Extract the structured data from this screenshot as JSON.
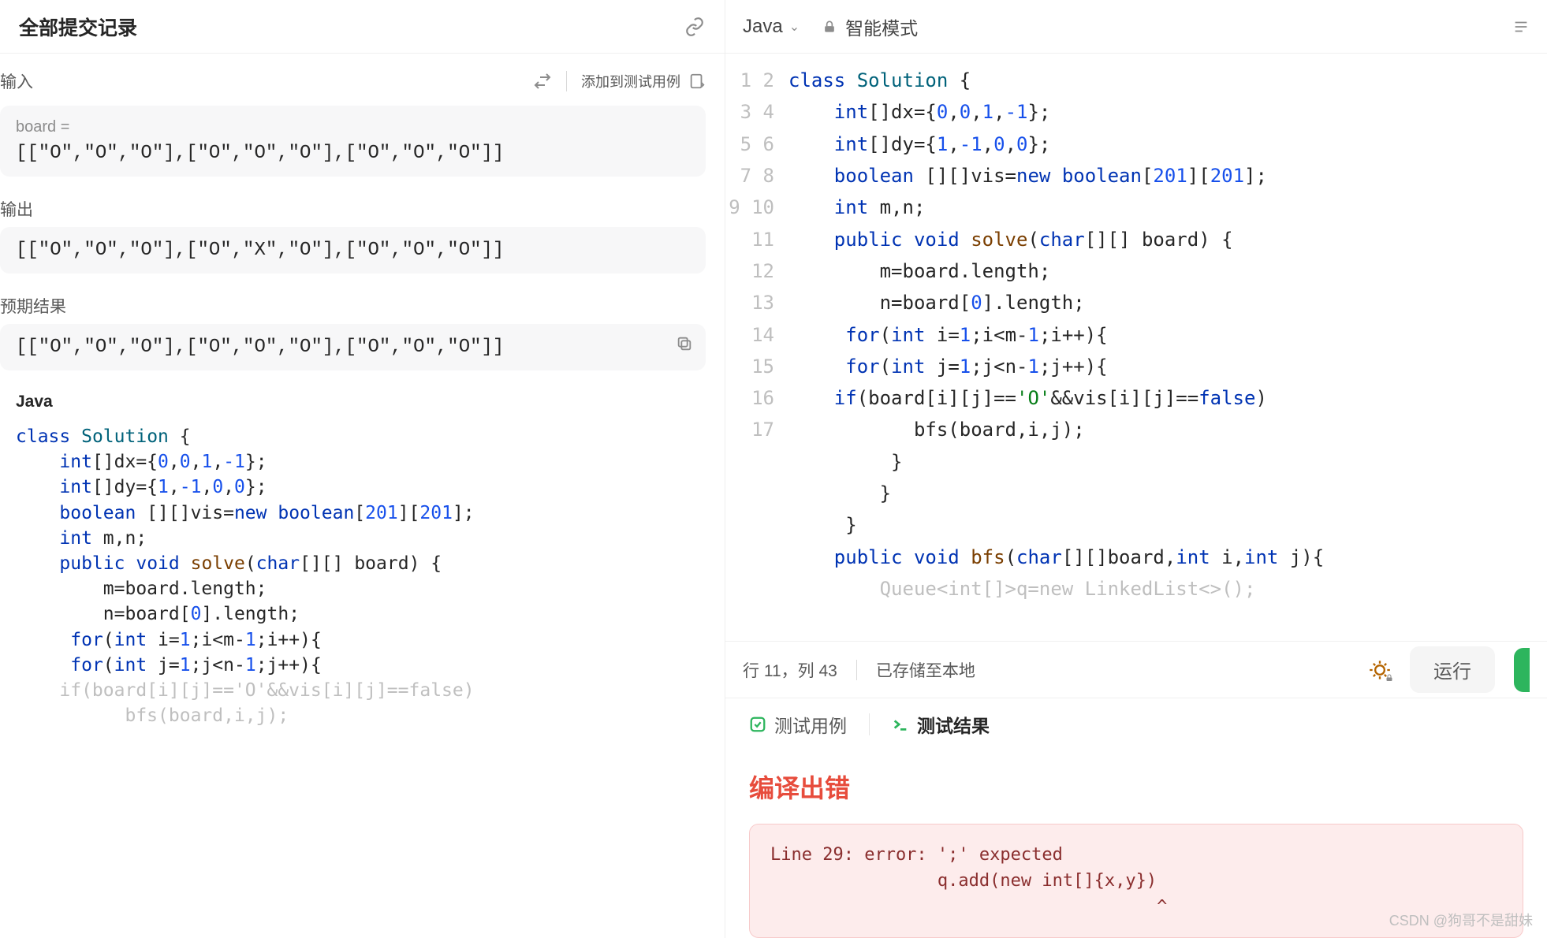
{
  "left": {
    "title": "全部提交记录",
    "input_label": "输入",
    "add_testcase": "添加到测试用例",
    "board_caption": "board =",
    "board_value": "[[\"O\",\"O\",\"O\"],[\"O\",\"O\",\"O\"],[\"O\",\"O\",\"O\"]]",
    "output_label": "输出",
    "output_value": "[[\"O\",\"O\",\"O\"],[\"O\",\"X\",\"O\"],[\"O\",\"O\",\"O\"]]",
    "expected_label": "预期结果",
    "expected_value": "[[\"O\",\"O\",\"O\"],[\"O\",\"O\",\"O\"],[\"O\",\"O\",\"O\"]]",
    "lang_label": "Java"
  },
  "right": {
    "language": "Java",
    "mode": "智能模式",
    "cursor": "行 11，列 43",
    "saved": "已存储至本地",
    "run_button": "运行"
  },
  "tabs": {
    "testcase": "测试用例",
    "result": "测试结果"
  },
  "error": {
    "title": "编译出错",
    "line1": "Line 29: error: ';' expected",
    "line2": "                q.add(new int[]{x,y})",
    "line3": "                                     ^"
  },
  "watermark": "CSDN @狗哥不是甜妹",
  "code_lines": 17,
  "chart_data": null
}
